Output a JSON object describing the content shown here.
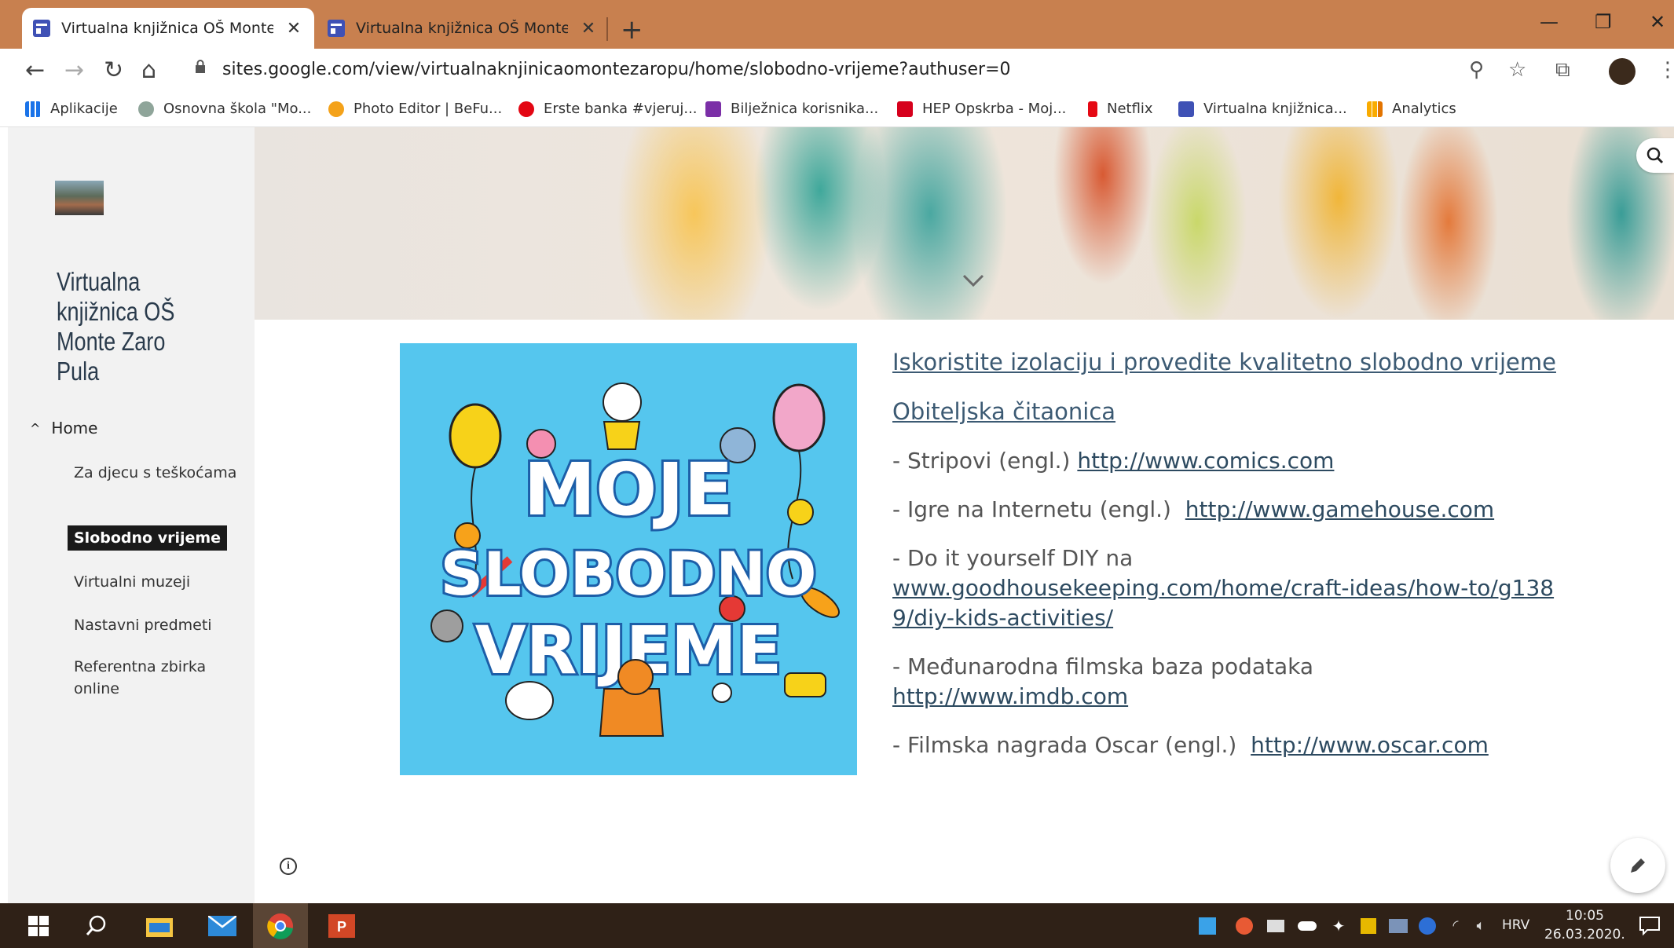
{
  "browser": {
    "tabs": [
      {
        "title": "Virtualna knjižnica OŠ Monte Zar",
        "active": true
      },
      {
        "title": "Virtualna knjižnica OŠ Monte Zar",
        "active": false
      }
    ],
    "new_tab": "+",
    "url": "sites.google.com/view/virtualnaknjinicaomontezaropu/home/slobodno-vrijeme?authuser=0",
    "bookmarks": [
      {
        "label": "Aplikacije",
        "icon": "apps-grid-icon",
        "color": "#1a73e8"
      },
      {
        "label": "Osnovna škola \"Mo...",
        "icon": "school-crest-icon",
        "color": "#8fa59a"
      },
      {
        "label": "Photo Editor | BeFu...",
        "icon": "photo-editor-icon",
        "color": "#f4a21a"
      },
      {
        "label": "Erste banka #vjeruj...",
        "icon": "erste-icon",
        "color": "#e30613"
      },
      {
        "label": "Bilježnica korisnika...",
        "icon": "onenote-icon",
        "color": "#7b2fa7"
      },
      {
        "label": "HEP Opskrba - Moj...",
        "icon": "hep-icon",
        "color": "#d6001c"
      },
      {
        "label": "Netflix",
        "icon": "netflix-icon",
        "color": "#e50914"
      },
      {
        "label": "Virtualna knjižnica...",
        "icon": "google-sites-icon",
        "color": "#3f51b5"
      },
      {
        "label": "Analytics",
        "icon": "analytics-icon",
        "color": "#f9ab00"
      }
    ]
  },
  "sidebar": {
    "site_title": "Virtualna knjižnica OŠ Monte Zaro Pula",
    "home_label": "Home",
    "items": [
      {
        "label": "Za djecu s teškoćama",
        "active": false
      },
      {
        "label": "Slobodno vrijeme",
        "active": true
      },
      {
        "label": "Virtualni muzeji",
        "active": false
      },
      {
        "label": "Nastavni predmeti",
        "active": false
      },
      {
        "label": "Referentna zbirka online",
        "active": false
      }
    ]
  },
  "hero_image": {
    "lines": [
      "MOJE",
      "SLOBODNO",
      "VRIJEME"
    ]
  },
  "content": {
    "heading1": "Iskoristite izolaciju i provedite kvalitetno slobodno vrijeme",
    "heading2": "Obiteljska čitaonica",
    "items": [
      {
        "prefix": "- Stripovi (engl.) ",
        "link": "http://www.comics.com"
      },
      {
        "prefix": "- Igre na Internetu (engl.)  ",
        "link": "http://www.gamehouse.com"
      },
      {
        "prefix": "- Do it yourself DIY na ",
        "link": "www.goodhousekeeping.com/home/craft-ideas/how-to/g1389/diy-kids-activities/"
      },
      {
        "prefix": "- Međunarodna filmska baza podataka ",
        "link": "http://www.imdb.com"
      },
      {
        "prefix": "- Filmska nagrada Oscar (engl.)  ",
        "link": "http://www.oscar.com"
      }
    ]
  },
  "taskbar": {
    "language": "HRV",
    "time": "10:05",
    "date": "26.03.2020."
  }
}
